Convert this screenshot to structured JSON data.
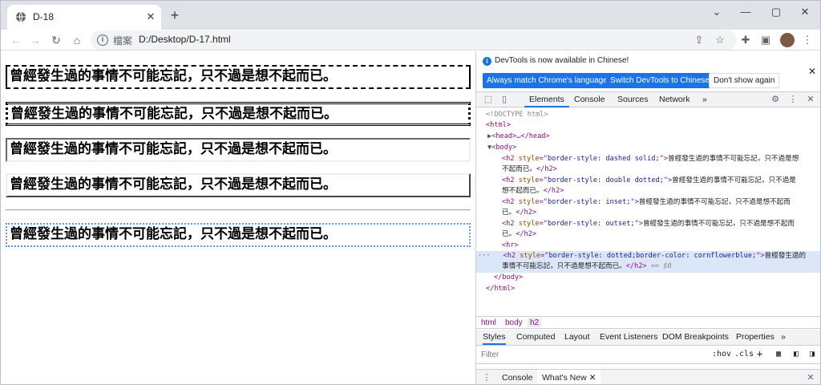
{
  "browser": {
    "tab_title": "D-18",
    "tab_close": "✕",
    "new_tab": "+",
    "window_controls": {
      "minimize": "—",
      "maximize": "▢",
      "close": "✕",
      "collapse": "⌄"
    },
    "nav": {
      "back": "←",
      "forward": "→",
      "reload": "↻",
      "home": "⌂"
    },
    "address": {
      "scheme_label": "檔案",
      "url": "D:/Desktop/D-17.html"
    }
  },
  "page": {
    "headings": [
      "曾經發生過的事情不可能忘記，只不過是想不起而已。",
      "曾經發生過的事情不可能忘記，只不過是想不起而已。",
      "曾經發生過的事情不可能忘記，只不過是想不起而已。",
      "曾經發生過的事情不可能忘記，只不過是想不起而已。",
      "曾經發生過的事情不可能忘記，只不過是想不起而已。"
    ]
  },
  "devtools": {
    "notice": {
      "text": "DevTools is now available in Chinese!",
      "btn_match": "Always match Chrome's language",
      "btn_switch": "Switch DevTools to Chinese",
      "btn_dismiss": "Don't show again"
    },
    "tabs": [
      "Elements",
      "Console",
      "Sources",
      "Network"
    ],
    "more_tabs": "»",
    "dom": {
      "doctype": "<!DOCTYPE html>",
      "html_open": "<html>",
      "head": "<head>…</head>",
      "body_open": "<body>",
      "h2_1_style": "border-style: dashed solid;",
      "h2_2_style": "border-style: double dotted;",
      "h2_3_style": "border-style: inset;",
      "h2_4_style": "border-style: outset;",
      "h2_5_style": "border-style: dotted;border-color: cornflowerblue;",
      "text_a": "曾經發生過的事情不可能忘記，只不過是想",
      "text_b": "不起而已。",
      "text_c": "曾經發生過的事情不可能忘記，只不過是",
      "text_d": "想不起而已。",
      "text_e": "曾經發生過的事情不可能忘記，只不過是想不起而",
      "text_f": "已。",
      "text_g": "曾經發生過的",
      "text_h": "事情不可能忘記，只不過是想不起而已。",
      "hr": "<hr>",
      "body_close": "</body>",
      "html_close": "</html>",
      "selected_marker": "== $0"
    },
    "crumbs": [
      "html",
      "body",
      "h2"
    ],
    "style_tabs": [
      "Styles",
      "Computed",
      "Layout",
      "Event Listeners",
      "DOM Breakpoints",
      "Properties"
    ],
    "filter_placeholder": "Filter",
    "filter_hov": ":hov",
    "filter_cls": ".cls",
    "drawer_tabs": [
      "Console",
      "What's New"
    ]
  }
}
